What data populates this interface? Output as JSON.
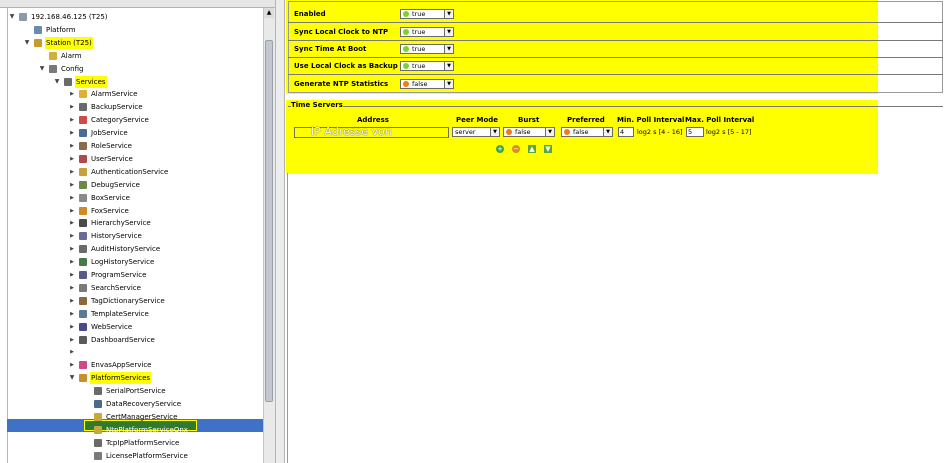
{
  "nav": {
    "tree": [
      {
        "label": "192.168.46.125 (T25)",
        "icon": "computer-icon",
        "level": 0,
        "expanded": true
      },
      {
        "label": "Platform",
        "icon": "platform-icon",
        "level": 1,
        "expanded": null
      },
      {
        "label": "Station (T25)",
        "icon": "station-icon",
        "level": 1,
        "expanded": true,
        "highlight": true
      },
      {
        "label": "Alarm",
        "icon": "alarm-icon",
        "level": 2,
        "expanded": null
      },
      {
        "label": "Config",
        "icon": "config-icon",
        "level": 2,
        "expanded": true
      },
      {
        "label": "Services",
        "icon": "services-icon",
        "level": 3,
        "expanded": true,
        "highlight": true
      },
      {
        "label": "AlarmService",
        "icon": "alarm-service-icon",
        "level": 4,
        "expanded": false
      },
      {
        "label": "BackupService",
        "icon": "backup-icon",
        "level": 4,
        "expanded": false
      },
      {
        "label": "CategoryService",
        "icon": "category-icon",
        "level": 4,
        "expanded": false
      },
      {
        "label": "JobService",
        "icon": "job-icon",
        "level": 4,
        "expanded": false
      },
      {
        "label": "RoleService",
        "icon": "role-icon",
        "level": 4,
        "expanded": false
      },
      {
        "label": "UserService",
        "icon": "user-icon",
        "level": 4,
        "expanded": false
      },
      {
        "label": "AuthenticationService",
        "icon": "authentication-icon",
        "level": 4,
        "expanded": false
      },
      {
        "label": "DebugService",
        "icon": "debug-icon",
        "level": 4,
        "expanded": false
      },
      {
        "label": "BoxService",
        "icon": "box-icon",
        "level": 4,
        "expanded": false
      },
      {
        "label": "FoxService",
        "icon": "fox-icon",
        "level": 4,
        "expanded": false
      },
      {
        "label": "HierarchyService",
        "icon": "hierarchy-icon",
        "level": 4,
        "expanded": false
      },
      {
        "label": "HistoryService",
        "icon": "history-icon",
        "level": 4,
        "expanded": false
      },
      {
        "label": "AuditHistoryService",
        "icon": "audit-history-icon",
        "level": 4,
        "expanded": false
      },
      {
        "label": "LogHistoryService",
        "icon": "log-history-icon",
        "level": 4,
        "expanded": false
      },
      {
        "label": "ProgramService",
        "icon": "program-icon",
        "level": 4,
        "expanded": false
      },
      {
        "label": "SearchService",
        "icon": "search-icon",
        "level": 4,
        "expanded": false
      },
      {
        "label": "TagDictionaryService",
        "icon": "tag-dictionary-icon",
        "level": 4,
        "expanded": false
      },
      {
        "label": "TemplateService",
        "icon": "template-icon",
        "level": 4,
        "expanded": false
      },
      {
        "label": "WebService",
        "icon": "web-icon",
        "level": 4,
        "expanded": false
      },
      {
        "label": "DashboardService",
        "icon": "dashboard-icon",
        "level": 4,
        "expanded": false
      },
      {
        "label": "",
        "icon": "",
        "level": 4,
        "expanded": false
      },
      {
        "label": "EnvasAppService",
        "icon": "envas-app-icon",
        "level": 4,
        "expanded": false
      },
      {
        "label": "PlatformServices",
        "icon": "platform-services-icon",
        "level": 4,
        "expanded": true,
        "highlight": true
      },
      {
        "label": "SerialPortService",
        "icon": "serial-port-icon",
        "level": 5,
        "expanded": null
      },
      {
        "label": "DataRecoveryService",
        "icon": "data-recovery-icon",
        "level": 5,
        "expanded": null
      },
      {
        "label": "CertManagerService",
        "icon": "cert-manager-icon",
        "level": 5,
        "expanded": null
      },
      {
        "label": "NtpPlatformServiceQnx",
        "icon": "ntp-icon",
        "level": 5,
        "expanded": null,
        "selected": true
      },
      {
        "label": "TcpIpPlatformService",
        "icon": "tcpip-icon",
        "level": 5,
        "expanded": null
      },
      {
        "label": "LicensePlatformService",
        "icon": "license-icon",
        "level": 5,
        "expanded": null
      }
    ]
  },
  "settings": {
    "rows": [
      {
        "label": "Enabled",
        "value": "true",
        "color": "#7dd12e"
      },
      {
        "label": "Sync Local Clock to NTP",
        "value": "true",
        "color": "#7dd12e"
      },
      {
        "label": "Sync Time At Boot",
        "value": "true",
        "color": "#7dd12e"
      },
      {
        "label": "Use Local Clock as Backup",
        "value": "true",
        "color": "#7dd12e"
      },
      {
        "label": "Generate NTP Statistics",
        "value": "false",
        "color": "#f07a1a"
      }
    ]
  },
  "time_servers": {
    "title": "Time Servers",
    "headers": {
      "address": "Address",
      "peer_mode": "Peer Mode",
      "burst": "Burst",
      "preferred": "Preferred",
      "min_poll": "Min. Poll Interval",
      "max_poll": "Max. Poll Interval"
    },
    "row": {
      "address": "IP Adresse von",
      "peer_mode": "server",
      "burst": "false",
      "preferred": "false",
      "min_poll": "4",
      "min_poll_unit": "log2 s [4 - 16]",
      "max_poll": "5",
      "max_poll_unit": "log2 s [5 - 17]"
    },
    "actions": [
      "add-icon",
      "remove-icon",
      "move-up-icon",
      "move-down-icon"
    ]
  },
  "colors": {
    "highlight": "#ffff00",
    "selection": "#3f72c7",
    "true": "#7dd12e",
    "false": "#f07a1a"
  }
}
